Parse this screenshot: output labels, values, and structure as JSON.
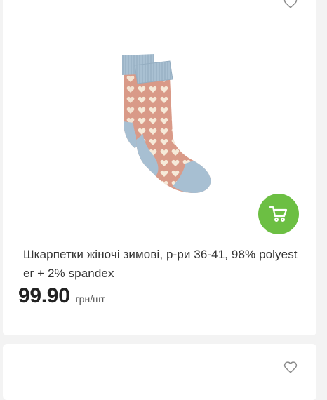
{
  "product": {
    "title": "Шкарпетки жіночі зимові, р-ри 36-41, 98% polyester + 2% spandex",
    "price": "99.90",
    "unit": "грн/шт",
    "image_alt": "winter-socks-image"
  },
  "icons": {
    "wishlist": "heart-icon",
    "cart": "cart-icon"
  },
  "colors": {
    "cart_button": "#6cbf43",
    "page_background": "#f3f3f3",
    "card_background": "#ffffff",
    "sock_body": "#d99a88",
    "sock_cuff": "#a7bfd2"
  }
}
